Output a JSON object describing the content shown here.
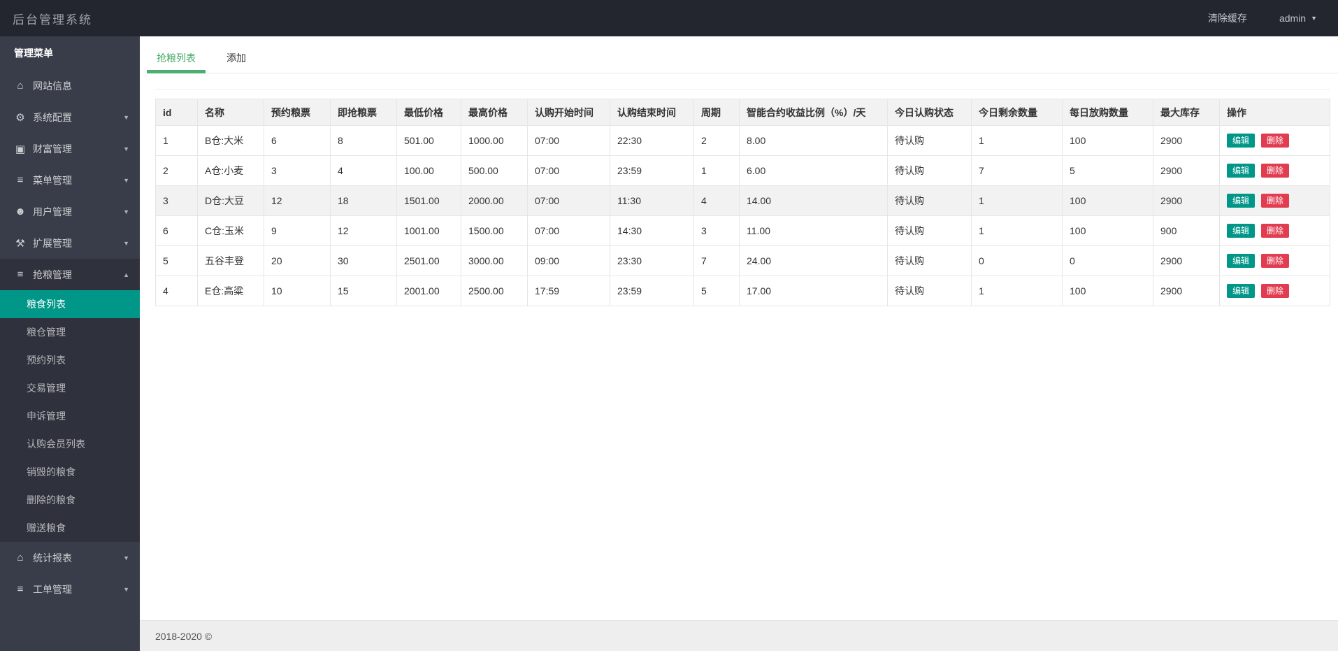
{
  "topbar": {
    "title": "后台管理系统",
    "clear_cache_label": "清除缓存",
    "username": "admin"
  },
  "sidebar": {
    "header": "管理菜单",
    "items": [
      {
        "label": "网站信息",
        "icon": "home-icon",
        "arrow": null
      },
      {
        "label": "系统配置",
        "icon": "gear-icon",
        "arrow": "down"
      },
      {
        "label": "财富管理",
        "icon": "money-icon",
        "arrow": "down"
      },
      {
        "label": "菜单管理",
        "icon": "bars-icon",
        "arrow": "down"
      },
      {
        "label": "用户管理",
        "icon": "users-icon",
        "arrow": "down"
      },
      {
        "label": "扩展管理",
        "icon": "wrench-icon",
        "arrow": "down"
      },
      {
        "label": "抢粮管理",
        "icon": "bars-icon",
        "arrow": "up",
        "expanded": true,
        "children": [
          {
            "label": "粮食列表",
            "active": true
          },
          {
            "label": "粮仓管理",
            "active": false
          },
          {
            "label": "预约列表",
            "active": false
          },
          {
            "label": "交易管理",
            "active": false
          },
          {
            "label": "申诉管理",
            "active": false
          },
          {
            "label": "认购会员列表",
            "active": false
          },
          {
            "label": "销毁的粮食",
            "active": false
          },
          {
            "label": "删除的粮食",
            "active": false
          },
          {
            "label": "赠送粮食",
            "active": false
          }
        ]
      },
      {
        "label": "统计报表",
        "icon": "home-icon",
        "arrow": "down"
      },
      {
        "label": "工单管理",
        "icon": "bars-icon",
        "arrow": "down"
      }
    ]
  },
  "tabs": [
    {
      "label": "抢粮列表",
      "active": true
    },
    {
      "label": "添加",
      "active": false
    }
  ],
  "table": {
    "columns": [
      "id",
      "名称",
      "预约粮票",
      "即抢粮票",
      "最低价格",
      "最高价格",
      "认购开始时间",
      "认购结束时间",
      "周期",
      "智能合约收益比例（%）/天",
      "今日认购状态",
      "今日剩余数量",
      "每日放购数量",
      "最大库存",
      "操作"
    ],
    "rows": [
      {
        "highlight": false,
        "cells": [
          "1",
          "B仓:大米",
          "6",
          "8",
          "501.00",
          "1000.00",
          "07:00",
          "22:30",
          "2",
          "8.00",
          "待认购",
          "1",
          "100",
          "2900"
        ]
      },
      {
        "highlight": false,
        "cells": [
          "2",
          "A仓:小麦",
          "3",
          "4",
          "100.00",
          "500.00",
          "07:00",
          "23:59",
          "1",
          "6.00",
          "待认购",
          "7",
          "5",
          "2900"
        ]
      },
      {
        "highlight": true,
        "cells": [
          "3",
          "D仓:大豆",
          "12",
          "18",
          "1501.00",
          "2000.00",
          "07:00",
          "11:30",
          "4",
          "14.00",
          "待认购",
          "1",
          "100",
          "2900"
        ]
      },
      {
        "highlight": false,
        "cells": [
          "6",
          "C仓:玉米",
          "9",
          "12",
          "1001.00",
          "1500.00",
          "07:00",
          "14:30",
          "3",
          "11.00",
          "待认购",
          "1",
          "100",
          "900"
        ]
      },
      {
        "highlight": false,
        "cells": [
          "5",
          "五谷丰登",
          "20",
          "30",
          "2501.00",
          "3000.00",
          "09:00",
          "23:30",
          "7",
          "24.00",
          "待认购",
          "0",
          "0",
          "2900"
        ]
      },
      {
        "highlight": false,
        "cells": [
          "4",
          "E仓:高粱",
          "10",
          "15",
          "2001.00",
          "2500.00",
          "17:59",
          "23:59",
          "5",
          "17.00",
          "待认购",
          "1",
          "100",
          "2900"
        ]
      }
    ],
    "actions": {
      "edit": "编辑",
      "delete": "删除"
    }
  },
  "footer": {
    "copyright": "2018-2020 ©"
  },
  "colors": {
    "topbar_bg": "#23262E",
    "sidebar_bg": "#393D49",
    "active_teal": "#009688",
    "tab_green": "#4CAE70",
    "edit_btn": "#009688",
    "delete_btn": "#E23C50",
    "header_row_bg": "#f2f2f2"
  }
}
